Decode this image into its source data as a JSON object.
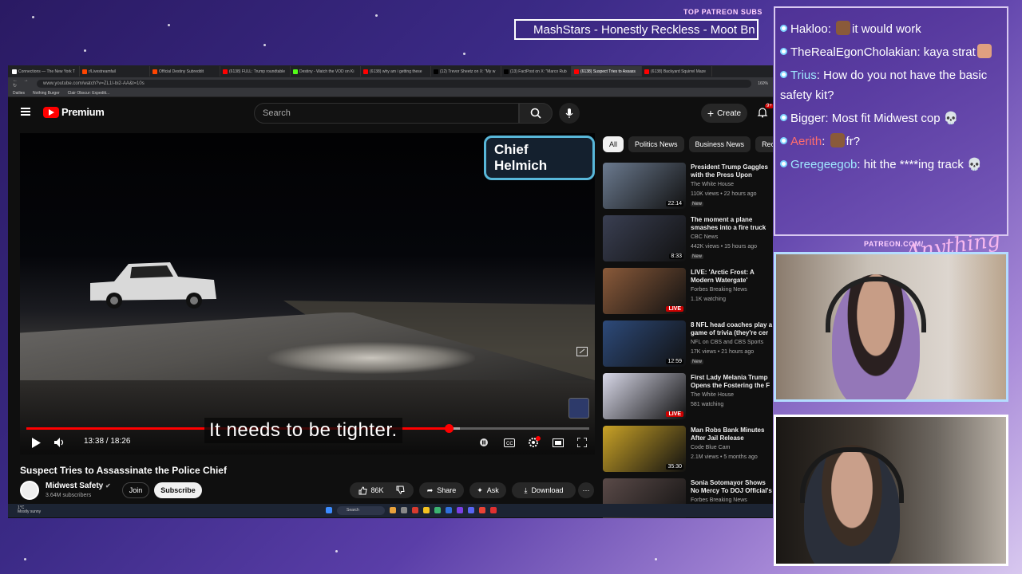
{
  "stream_overlay": {
    "patreon_label": "TOP PATREON SUBS",
    "ticker_text": "MashStars - Honestly Reckless - Moot Bn",
    "patreon_link": "PATREON.COM/",
    "brand_script": "Anything Else"
  },
  "browser": {
    "tabs": [
      {
        "label": "Connections — The New York T",
        "color": "#ffffff"
      },
      {
        "label": "r/Livestreamfail",
        "color": "#ff4500"
      },
      {
        "label": "Official Destiny Subreddit",
        "color": "#ff4500"
      },
      {
        "label": "(6138) FULL: Trump roundtable",
        "color": "#ff0000"
      },
      {
        "label": "Destiny - Watch the VOD on Ki",
        "color": "#53fc18"
      },
      {
        "label": "(6138) why am i getting these",
        "color": "#ff0000"
      },
      {
        "label": "(12) Trevor Sheetz on X: \"My w",
        "color": "#000000"
      },
      {
        "label": "(13) FactPost on X: \"Marco Rub",
        "color": "#000000"
      },
      {
        "label": "(6138) Suspect Tries to Assass",
        "color": "#ff0000"
      },
      {
        "label": "(6138) Backyard Squirrel Maze",
        "color": "#ff0000"
      }
    ],
    "active_tab_index": 8,
    "url": "www.youtube.com/watch?v=ZL1I-bi2-AA&t=10s",
    "zoom": "160%",
    "bookmarks": [
      "Dailies",
      "Nothing Burger",
      "Clair Obscur: Expediti..."
    ]
  },
  "youtube": {
    "logo_text": "Premium",
    "search_placeholder": "Search",
    "create_label": "Create",
    "notification_count": "9+",
    "video": {
      "overlay_label": "Chief Helmich",
      "caption": "It needs to be tighter.",
      "time": "13:38 / 18:26",
      "progress": 0.75,
      "title": "Suspect Tries to Assassinate the Police Chief",
      "channel": "Midwest Safety",
      "subscribers": "3.64M subscribers",
      "join_label": "Join",
      "subscribe_label": "Subscribe",
      "likes": "86K",
      "share_label": "Share",
      "ask_label": "Ask",
      "download_label": "Download"
    },
    "chips": [
      {
        "label": "All",
        "active": true
      },
      {
        "label": "Politics News",
        "active": false
      },
      {
        "label": "Business News",
        "active": false
      },
      {
        "label": "Rece",
        "active": false
      }
    ],
    "recommendations": [
      {
        "title": "President Trump Gaggles with the Press Upon Departure in F",
        "channel": "The White House",
        "meta": "110K views • 22 hours ago",
        "badge": "22:14",
        "badge_type": "duration",
        "new": true,
        "thumb": "#6b7a8f"
      },
      {
        "title": "The moment a plane smashes into a fire truck at LaGuardia",
        "channel": "CBC News",
        "meta": "442K views • 15 hours ago",
        "badge": "8:33",
        "badge_type": "duration",
        "new": true,
        "thumb": "#3a3f52"
      },
      {
        "title": "LIVE: 'Arctic Frost: A Modern Watergate' Hearing Held B",
        "channel": "Forbes Breaking News",
        "meta": "1.1K watching",
        "badge": "LIVE",
        "badge_type": "live",
        "new": false,
        "thumb": "#8a5a3a"
      },
      {
        "title": "8 NFL head coaches play a game of trivia (they're cer",
        "channel": "NFL on CBS and CBS Sports",
        "meta": "17K views • 21 hours ago",
        "badge": "12:59",
        "badge_type": "duration",
        "new": true,
        "thumb": "#2d4a7a"
      },
      {
        "title": "First Lady Melania Trump Opens the Fostering the F",
        "channel": "The White House",
        "meta": "581 watching",
        "badge": "LIVE",
        "badge_type": "live",
        "new": false,
        "thumb": "#d8d8e8"
      },
      {
        "title": "Man Robs Bank Minutes After Jail Release",
        "channel": "Code Blue Cam",
        "meta": "2.1M views • 5 months ago",
        "badge": "35:30",
        "badge_type": "duration",
        "new": false,
        "thumb": "#c9a227"
      },
      {
        "title": "Sonia Sotomayor Shows No Mercy To DOJ Official's",
        "channel": "Forbes Breaking News",
        "meta": "",
        "badge": "",
        "badge_type": "none",
        "new": false,
        "thumb": "#5a4a48"
      }
    ]
  },
  "taskbar": {
    "weather_temp": "1°C",
    "weather_desc": "Mostly sunny",
    "search_label": "Search"
  },
  "chat": [
    {
      "user": "Hakloo",
      "color": "white",
      "text": "it would work",
      "emote_before": true
    },
    {
      "user": "TheRealEgonCholakian",
      "color": "white",
      "text": "kaya strat",
      "emote_after": true
    },
    {
      "user": "Trius",
      "color": "teal",
      "text": "How do you not have the basic safety kit?"
    },
    {
      "user": "Bigger",
      "color": "white",
      "text": "Most fit Midwest cop 💀"
    },
    {
      "user": "Aerith",
      "color": "red",
      "text": "fr?",
      "emote_before": true
    },
    {
      "user": "Greegeegob",
      "color": "teal",
      "text": "hit the ****ing track 💀"
    }
  ],
  "colors": {
    "accent_red": "#ff0000",
    "caption_border": "#58b7d9",
    "chat_border": "#d8c8f0"
  }
}
